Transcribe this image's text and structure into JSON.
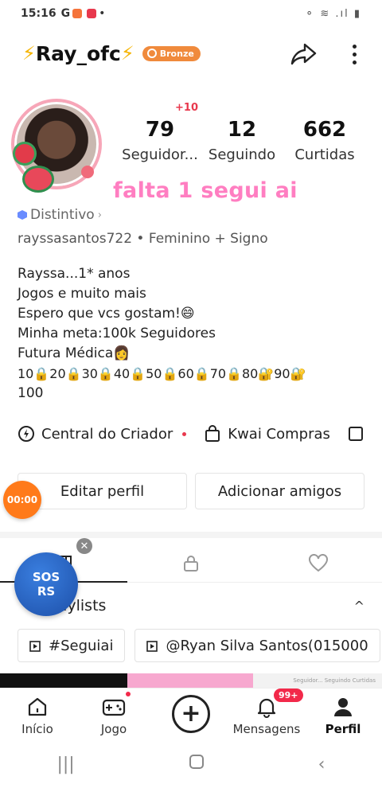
{
  "status_bar": {
    "time": "15:16",
    "letter": "G",
    "right_icons": "⚬ ≋ .ıl ▮"
  },
  "header": {
    "username": "Ray_ofc",
    "bolt": "⚡",
    "badge_label": "Bronze"
  },
  "stats": {
    "followers_plus": "+10",
    "followers": "79",
    "followers_label": "Seguidor...",
    "following": "12",
    "following_label": "Seguindo",
    "likes": "662",
    "likes_label": "Curtidas"
  },
  "pink_caption": "falta 1 segui ai",
  "distintivo": "Distintivo",
  "meta_line": "rayssasantos722 • Feminino    + Signo",
  "bio": [
    "Rayssa...1* anos",
    "Jogos e muito mais",
    "Espero que vcs gostam!😄",
    "Minha meta:100k Seguidores",
    "Futura Médica👩",
    "10🔒20🔒30🔒40🔒50🔒60🔒70🔒80🔐90🔐",
    "100"
  ],
  "links": {
    "creator_center": "Central do Criador",
    "kwai_shop": "Kwai Compras"
  },
  "actions": {
    "edit_profile": "Editar perfil",
    "add_friends": "Adicionar amigos"
  },
  "timer": "00:00",
  "sos": {
    "line1": "SOS",
    "line2": "RS",
    "close": "✕"
  },
  "playlists": {
    "label": "Playlists",
    "caret": "^"
  },
  "chips": [
    "#Seguiai",
    "@Ryan Silva Santos(015000"
  ],
  "strip_text": "Seguidor... Seguindo Curtidas",
  "bottom_nav": {
    "home": "Início",
    "game": "Jogo",
    "messages": "Mensagens",
    "messages_badge": "99+",
    "profile": "Perfil"
  },
  "colors": {
    "accent_pink": "#ff7ec1",
    "badge_orange": "#f08a3c",
    "notif_red": "#f2294a"
  }
}
